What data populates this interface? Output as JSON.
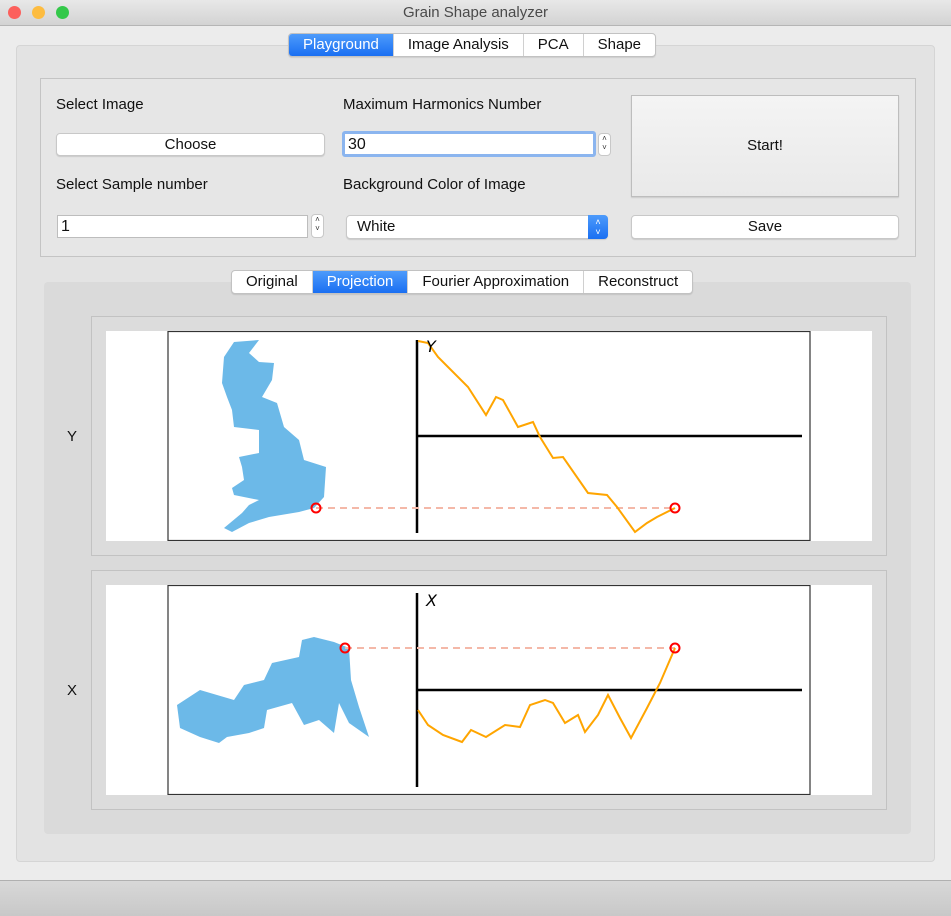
{
  "window": {
    "title": "Grain Shape analyzer"
  },
  "main_tabs": [
    {
      "label": "Playground",
      "active": true
    },
    {
      "label": "Image Analysis"
    },
    {
      "label": "PCA"
    },
    {
      "label": "Shape"
    }
  ],
  "controls": {
    "select_image_label": "Select Image",
    "choose_button": "Choose",
    "max_harmonics_label": "Maximum Harmonics Number",
    "max_harmonics_value": "30",
    "sample_number_label": "Select Sample number",
    "sample_number_value": "1",
    "bg_color_label": "Background Color of Image",
    "bg_color_value": "White",
    "start_button": "Start!",
    "save_button": "Save"
  },
  "view_tabs": [
    {
      "label": "Original"
    },
    {
      "label": "Projection",
      "active": true
    },
    {
      "label": "Fourier Approximation"
    },
    {
      "label": "Reconstruct"
    }
  ],
  "plots": [
    {
      "row_label": "Y",
      "axis_label": "Y"
    },
    {
      "row_label": "X",
      "axis_label": "X"
    }
  ],
  "colors": {
    "accent": "#1a6ff2",
    "shape_fill": "#6cb9e8",
    "curve": "#ffa500",
    "marker": "#ff0000",
    "guide": "#f4b8a8"
  }
}
